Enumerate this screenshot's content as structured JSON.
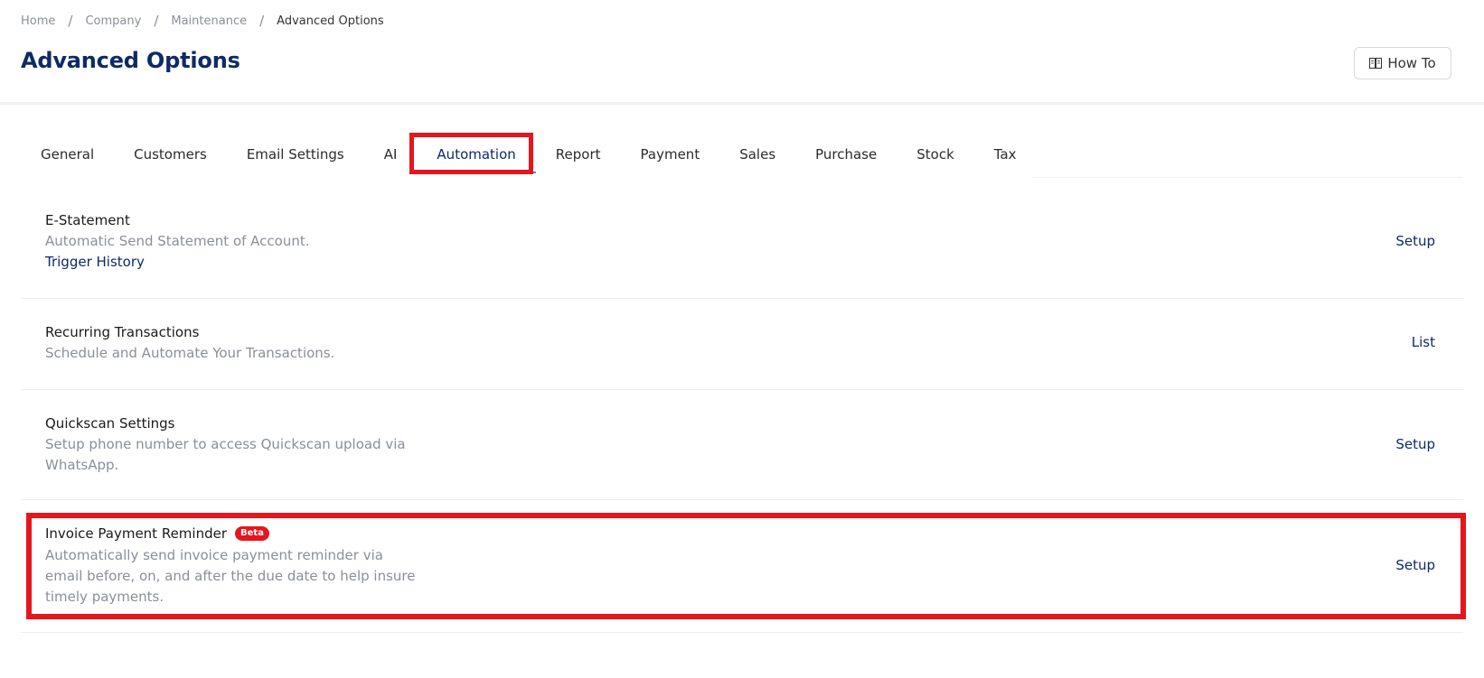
{
  "breadcrumb": [
    "Home",
    "Company",
    "Maintenance",
    "Advanced Options"
  ],
  "page_title": "Advanced Options",
  "how_to_label": "How To",
  "tabs": [
    {
      "label": "General"
    },
    {
      "label": "Customers"
    },
    {
      "label": "Email Settings"
    },
    {
      "label": "AI"
    },
    {
      "label": "Automation",
      "active": true
    },
    {
      "label": "Report"
    },
    {
      "label": "Payment"
    },
    {
      "label": "Sales"
    },
    {
      "label": "Purchase"
    },
    {
      "label": "Stock"
    },
    {
      "label": "Tax"
    }
  ],
  "rows": [
    {
      "title": "E-Statement",
      "description": "Automatic Send Statement of Account.",
      "link": "Trigger History",
      "action": "Setup"
    },
    {
      "title": "Recurring Transactions",
      "description": "Schedule and Automate Your Transactions.",
      "action": "List"
    },
    {
      "title": "Quickscan Settings",
      "description": "Setup phone number to access Quickscan upload via WhatsApp.",
      "action": "Setup"
    },
    {
      "title": "Invoice Payment Reminder",
      "badge": "Beta",
      "description": "Automatically send invoice payment reminder via email before, on, and after the due date to help insure timely payments.",
      "action": "Setup"
    }
  ],
  "colors": {
    "accent": "#0e2a66",
    "highlight": "#e5161d",
    "tab_underline": "#3d8fd6"
  }
}
